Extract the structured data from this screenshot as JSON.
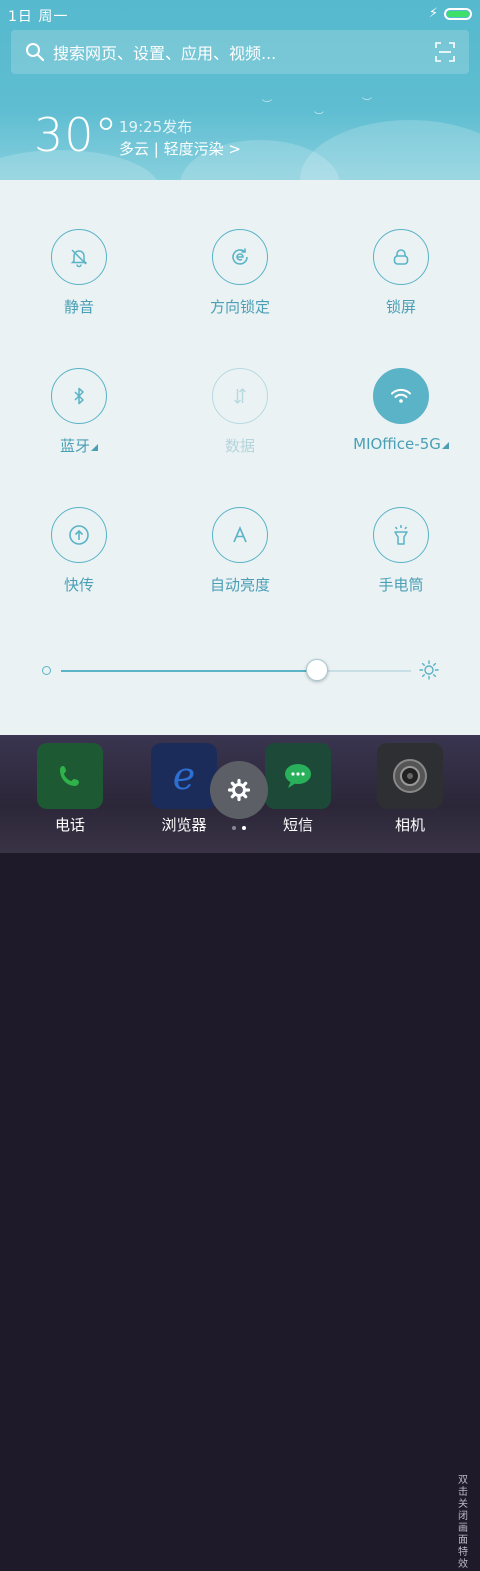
{
  "status_bar": {
    "time": "1日  周一",
    "charging_icon": "bolt-icon",
    "battery_level": 0.9
  },
  "search": {
    "placeholder": "搜索网页、设置、应用、视频..."
  },
  "weather": {
    "temperature": "30°",
    "publish_time": "19:25发布",
    "condition": "多云 | 轻度污染 >"
  },
  "toggles": [
    {
      "label": "静音",
      "icon": "bell-off-icon",
      "state": "off"
    },
    {
      "label": "方向锁定",
      "icon": "rotation-lock-icon",
      "state": "off"
    },
    {
      "label": "锁屏",
      "icon": "lock-icon",
      "state": "off"
    },
    {
      "label": "蓝牙",
      "icon": "bluetooth-icon",
      "state": "off",
      "has_submenu": true
    },
    {
      "label": "数据",
      "icon": "mobile-data-icon",
      "state": "disabled"
    },
    {
      "label": "MIOffice-5G",
      "icon": "wifi-icon",
      "state": "on",
      "has_submenu": true
    },
    {
      "label": "快传",
      "icon": "transfer-icon",
      "state": "off"
    },
    {
      "label": "自动亮度",
      "icon": "auto-brightness-icon",
      "state": "off"
    },
    {
      "label": "手电筒",
      "icon": "flashlight-icon",
      "state": "off"
    }
  ],
  "brightness": {
    "level": 0.73
  },
  "dock": [
    {
      "label": "电话",
      "icon": "phone-icon",
      "color": "#2fb24a"
    },
    {
      "label": "浏览器",
      "icon": "browser-icon",
      "color": "#2d6fd1"
    },
    {
      "label": "短信",
      "icon": "message-icon",
      "color": "#29b05a"
    },
    {
      "label": "相机",
      "icon": "camera-icon",
      "color": "#3a3a3a"
    }
  ],
  "home": {
    "side_hint": "双击关闭画面特效"
  },
  "colors": {
    "accent": "#5ab3c6",
    "panel_bg": "#eaf2f4",
    "header_bg": "#5ebdd1"
  }
}
